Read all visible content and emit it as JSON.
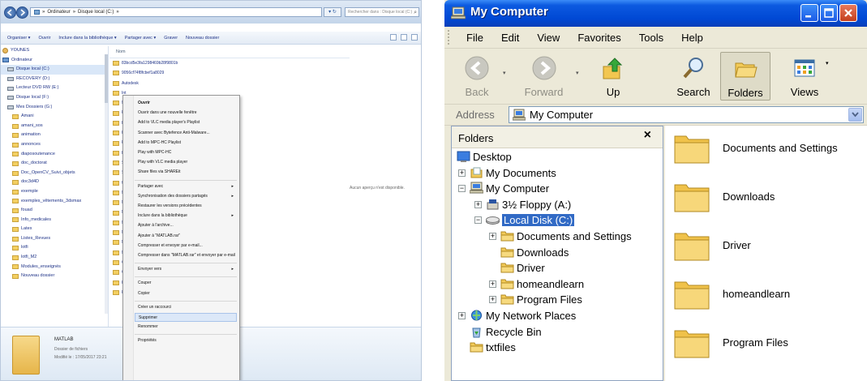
{
  "win7": {
    "breadcrumb": [
      "Ordinateur",
      "Disque local (C:)"
    ],
    "search_placeholder": "Rechercher dans : Disque local (C:)",
    "toolbar": [
      "Organiser ▾",
      "Ouvrir",
      "Inclure dans la bibliothèque ▾",
      "Partager avec ▾",
      "Graver",
      "Nouveau dossier"
    ],
    "nav_items": [
      {
        "label": "YOUNES",
        "icon": "user"
      },
      {
        "label": "Ordinateur",
        "icon": "computer"
      },
      {
        "label": "Disque local (C:)",
        "icon": "drive",
        "selected": true
      },
      {
        "label": "RECOVERY (D:)",
        "icon": "drive"
      },
      {
        "label": "Lecteur DVD RW (E:)",
        "icon": "drive"
      },
      {
        "label": "Disque local (F:)",
        "icon": "drive"
      },
      {
        "label": "Mes Dossiers (G:)",
        "icon": "drive"
      },
      {
        "label": "Amani",
        "icon": "folder"
      },
      {
        "label": "amani_sos",
        "icon": "folder"
      },
      {
        "label": "animation",
        "icon": "folder"
      },
      {
        "label": "annonces",
        "icon": "folder"
      },
      {
        "label": "diaposoutenance",
        "icon": "folder"
      },
      {
        "label": "doc_doctorat",
        "icon": "folder"
      },
      {
        "label": "Doc_OpenCV_Suivi_objets",
        "icon": "folder"
      },
      {
        "label": "doc3d4D",
        "icon": "folder"
      },
      {
        "label": "exemple",
        "icon": "folder"
      },
      {
        "label": "exemples_vêtements_3dsmax",
        "icon": "folder"
      },
      {
        "label": "fouad",
        "icon": "folder"
      },
      {
        "label": "Info_medicales",
        "icon": "folder"
      },
      {
        "label": "Latex",
        "icon": "folder"
      },
      {
        "label": "Listes_Revues",
        "icon": "folder"
      },
      {
        "label": "lotfi",
        "icon": "folder"
      },
      {
        "label": "lotfi_M2",
        "icon": "folder"
      },
      {
        "label": "Modules_enseignés",
        "icon": "folder"
      },
      {
        "label": "Nouveau dossier",
        "icon": "folder"
      }
    ],
    "column_header": "Nom",
    "files": [
      "83bcd5e3fa1298469b28f9801b",
      "9056cf74f8fcbef1a8029",
      "Autodesk",
      "Int",
      "Ne",
      "Pe",
      "Pr",
      "Pr",
      "Pr",
      "Ra",
      "Sa",
      "Sh",
      "Us",
      "M",
      "M",
      "M",
      "M",
      "M",
      "M",
      "M",
      "O",
      "O",
      "Pe",
      "Pr"
    ],
    "preview_text": "Aucun aperçu n'est disponible.",
    "details": {
      "name": "MATLAB",
      "type": "Dossier de fichiers",
      "modified": "Modifié le : 17/05/2017 23:21"
    },
    "context_menu": [
      {
        "label": "Ouvrir",
        "bold": true
      },
      {
        "label": "Ouvrir dans une nouvelle fenêtre"
      },
      {
        "label": "Add to VLC media player's Playlist"
      },
      {
        "label": "Scanner avec Bytefence Anti-Malware..."
      },
      {
        "label": "Add to MPC-HC Playlist"
      },
      {
        "label": "Play with MPC-HC"
      },
      {
        "label": "Play with VLC media player"
      },
      {
        "label": "Share files via SHAREit"
      },
      {
        "sep": true
      },
      {
        "label": "Partager avec",
        "sub": true
      },
      {
        "label": "Synchronisation des dossiers partagés",
        "sub": true
      },
      {
        "label": "Restaurer les versions précédentes"
      },
      {
        "label": "Inclure dans la bibliothèque",
        "sub": true
      },
      {
        "label": "Ajouter à l'archive..."
      },
      {
        "label": "Ajouter à \"MATLAB.rar\""
      },
      {
        "label": "Compresser et envoyer par e-mail..."
      },
      {
        "label": "Compresser dans \"MATLAB.rar\" et envoyer par e-mail"
      },
      {
        "sep": true
      },
      {
        "label": "Envoyer vers",
        "sub": true
      },
      {
        "sep": true
      },
      {
        "label": "Couper"
      },
      {
        "label": "Copier"
      },
      {
        "sep": true
      },
      {
        "label": "Créer un raccourci"
      },
      {
        "label": "Supprimer",
        "highlight": true
      },
      {
        "label": "Renommer"
      },
      {
        "sep": true
      },
      {
        "label": "Propriétés"
      }
    ]
  },
  "xp": {
    "title": "My Computer",
    "menu": [
      "File",
      "Edit",
      "View",
      "Favorites",
      "Tools",
      "Help"
    ],
    "toolbar": {
      "back": "Back",
      "forward": "Forward",
      "up": "Up",
      "search": "Search",
      "folders": "Folders",
      "views": "Views"
    },
    "address_label": "Address",
    "address_value": "My Computer",
    "folders_title": "Folders",
    "folders_close": "×",
    "tree": [
      {
        "label": "Desktop",
        "level": 0,
        "icon": "desktop",
        "pm": ""
      },
      {
        "label": "My Documents",
        "level": 1,
        "icon": "mydocs",
        "pm": "+"
      },
      {
        "label": "My Computer",
        "level": 1,
        "icon": "computer",
        "pm": "−"
      },
      {
        "label": "3½ Floppy (A:)",
        "level": 2,
        "icon": "floppy",
        "pm": "+"
      },
      {
        "label": "Local Disk (C:)",
        "level": 2,
        "icon": "disk",
        "pm": "−",
        "selected": true
      },
      {
        "label": "Documents and Settings",
        "level": 3,
        "icon": "folder",
        "pm": "+"
      },
      {
        "label": "Downloads",
        "level": 3,
        "icon": "folder",
        "pm": ""
      },
      {
        "label": "Driver",
        "level": 3,
        "icon": "folder",
        "pm": ""
      },
      {
        "label": "homeandlearn",
        "level": 3,
        "icon": "folder",
        "pm": "+"
      },
      {
        "label": "Program Files",
        "level": 3,
        "icon": "folder",
        "pm": "+"
      },
      {
        "label": "My Network Places",
        "level": 1,
        "icon": "network",
        "pm": "+"
      },
      {
        "label": "Recycle Bin",
        "level": 1,
        "icon": "recycle",
        "pm": ""
      },
      {
        "label": "txtfiles",
        "level": 1,
        "icon": "folder",
        "pm": ""
      }
    ],
    "contents": [
      "Documents and Settings",
      "Downloads",
      "Driver",
      "homeandlearn",
      "Program Files"
    ]
  }
}
